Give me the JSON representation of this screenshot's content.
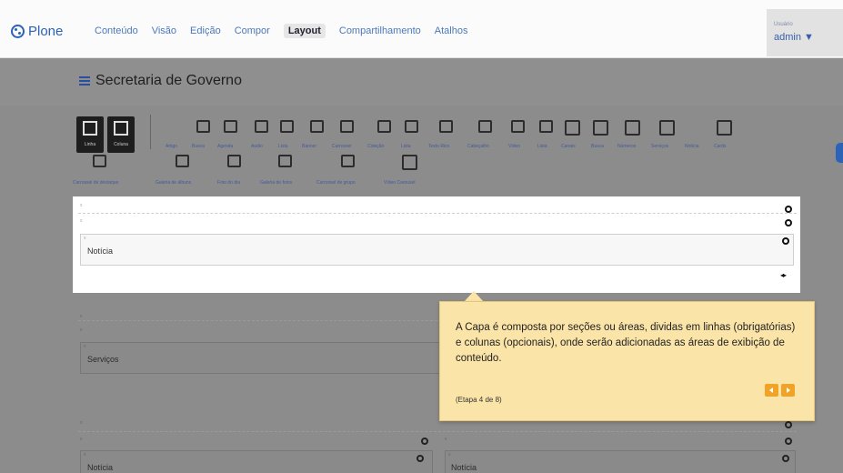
{
  "topbar": {
    "logo": "Plone",
    "nav": [
      "Conteúdo",
      "Visão",
      "Edição",
      "Compor",
      "Layout",
      "Compartilhamento",
      "Atalhos"
    ],
    "active_nav": "Layout",
    "user_label": "Usuário",
    "user_name": "admin ▼"
  },
  "page": {
    "title": "Secretaria de Governo"
  },
  "palette": {
    "big_buttons": [
      "Linha",
      "Coluna"
    ],
    "row1": [
      "Artigo",
      "Busca",
      "Agenda",
      "Audio",
      "Lista",
      "Banner",
      "Carrossel",
      "Coleção",
      "Lista",
      "Texto Rico",
      "Cabeçalho",
      "Vídeo",
      "Lista",
      "Canais",
      "Busca",
      "Números",
      "Serviços",
      "Notícia",
      "Cards"
    ],
    "row2": [
      "Carrossel de destaque",
      "Galeria de álbuns",
      "Foto do dia",
      "Galeria de fotos",
      "Carrossel de grupo",
      "Vídeo Carousel"
    ]
  },
  "layout": {
    "tile_highlight": "Notícia",
    "tile_servicos": "Serviços",
    "tile_noticia_left": "Notícia",
    "tile_noticia_right": "Notícia",
    "mark": "x"
  },
  "tooltip": {
    "text": "A Capa é composta por seções ou áreas, dividas em linhas (obrigatórias) e colunas (opcionais), onde serão adicionadas as áreas de exibição de conteúdo.",
    "step": "(Etapa 4 de 8)"
  },
  "colors": {
    "accent": "#2a63b8",
    "tooltip_bg": "#fbe4a8",
    "tooltip_button": "#f0a326"
  }
}
